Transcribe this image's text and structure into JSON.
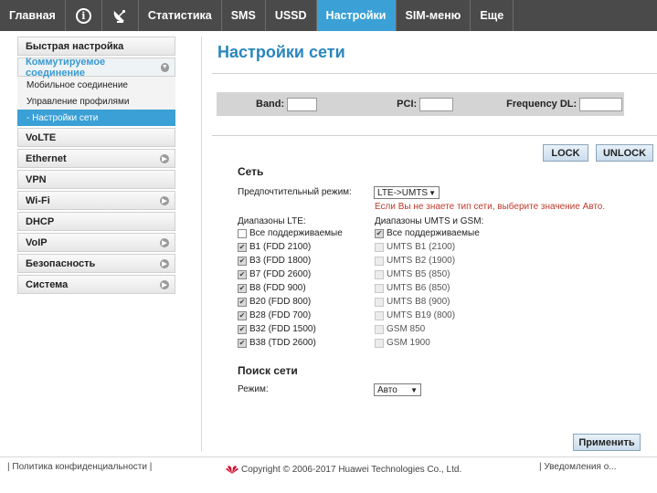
{
  "nav": {
    "items": [
      "Главная",
      "Статистика",
      "SMS",
      "USSD",
      "Настройки",
      "SIM-меню",
      "Еще"
    ],
    "active": "Настройки",
    "info_icon": "info-icon",
    "update_icon": "satellite-dish-icon"
  },
  "sidebar": {
    "quick_setup": "Быстрая настройка",
    "dialup": "Коммутируемое соединение",
    "sub": [
      "Мобильное соединение",
      "Управление профилями",
      "- Настройки сети"
    ],
    "items": [
      "VoLTE",
      "Ethernet",
      "VPN",
      "Wi-Fi",
      "DHCP",
      "VoIP",
      "Безопасность",
      "Система"
    ]
  },
  "main": {
    "title": "Настройки сети",
    "band_label": "Band:",
    "pci_label": "PCI:",
    "freq_label": "Frequency DL:",
    "lock_btn": "LOCK",
    "unlock_btn": "UNLOCK",
    "network_heading": "Сеть",
    "preferred_mode_label": "Предпочтительный режим:",
    "preferred_mode_value": "LTE->UMTS",
    "mode_warning": "Если Вы не знаете тип сети, выберите значение Авто.",
    "lte_bands_label": "Диапазоны LTE:",
    "umts_bands_label": "Диапазоны UMTS и GSM:",
    "lte_bands": [
      {
        "label": "Все поддерживаемые",
        "checked": false
      },
      {
        "label": "B1 (FDD 2100)",
        "checked": true
      },
      {
        "label": "B3 (FDD 1800)",
        "checked": true
      },
      {
        "label": "B7 (FDD 2600)",
        "checked": true
      },
      {
        "label": "B8 (FDD 900)",
        "checked": true
      },
      {
        "label": "B20 (FDD 800)",
        "checked": true
      },
      {
        "label": "B28 (FDD 700)",
        "checked": true
      },
      {
        "label": "B32 (FDD 1500)",
        "checked": true
      },
      {
        "label": "B38 (TDD 2600)",
        "checked": true
      }
    ],
    "umts_bands": [
      {
        "label": "Все поддерживаемые",
        "checked": true
      },
      {
        "label": "UMTS B1 (2100)",
        "checked": false
      },
      {
        "label": "UMTS B2 (1900)",
        "checked": false
      },
      {
        "label": "UMTS B5 (850)",
        "checked": false
      },
      {
        "label": "UMTS B6 (850)",
        "checked": false
      },
      {
        "label": "UMTS B8 (900)",
        "checked": false
      },
      {
        "label": "UMTS B19 (800)",
        "checked": false
      },
      {
        "label": "GSM 850",
        "checked": false
      },
      {
        "label": "GSM 1900",
        "checked": false
      }
    ],
    "search_heading": "Поиск сети",
    "search_mode_label": "Режим:",
    "search_mode_value": "Авто",
    "apply_btn": "Применить"
  },
  "footer": {
    "privacy": "Политика конфиденциальности",
    "copyright": "Copyright © 2006-2017 Huawei Technologies Co., Ltd.",
    "notice": "Уведомления о..."
  },
  "colors": {
    "nav_bg": "#4a4a4a",
    "accent": "#3aa0d5",
    "title": "#2a86bd",
    "warning": "#c0392b",
    "brand": "#cf0a2c"
  }
}
